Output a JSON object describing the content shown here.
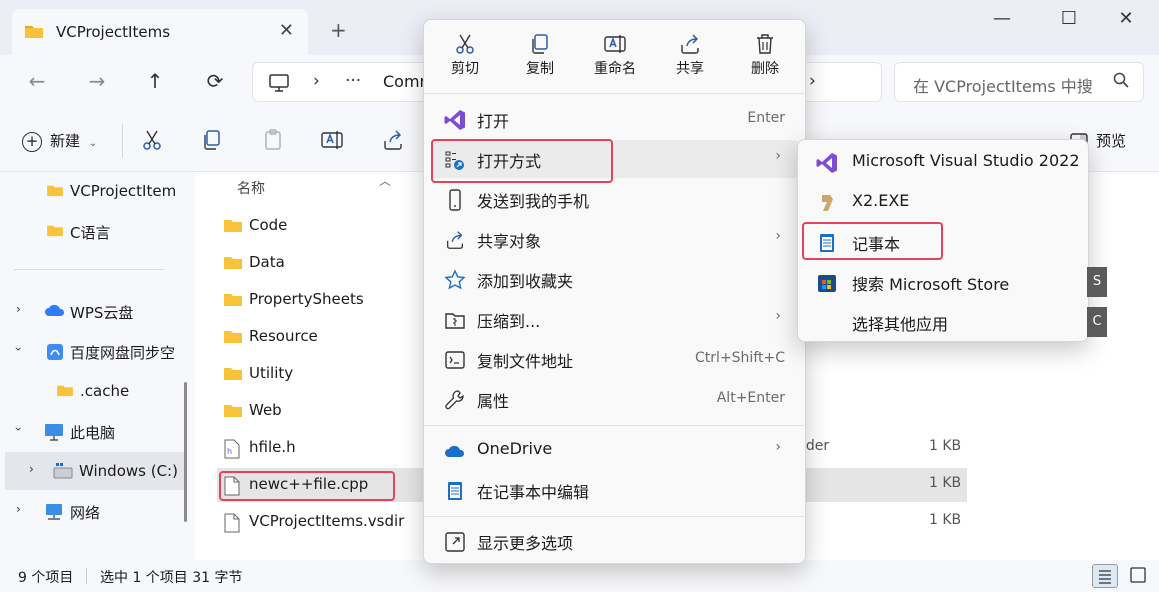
{
  "window": {
    "tab_title": "VCProjectItems",
    "tab_close": "✕",
    "new_tab": "+",
    "minimize": "—",
    "maximize": "☐",
    "close": "✕"
  },
  "nav": {
    "back": "←",
    "forward": "→",
    "up": "↑",
    "refresh": "⟳",
    "address_sep1": "›",
    "address_more": "···",
    "address_crumb": "Comm",
    "address_sep2": "›",
    "search_placeholder": "在 VCProjectItems 中搜"
  },
  "toolbar": {
    "new_label": "新建",
    "preview_label": "预览"
  },
  "sidebar": {
    "items": [
      {
        "label": "VCProjectItem",
        "icon": "folder-icon"
      },
      {
        "label": "C语言",
        "icon": "folder-icon"
      },
      {
        "label": "WPS云盘",
        "icon": "cloud-icon"
      },
      {
        "label": "百度网盘同步空",
        "icon": "baidu-icon"
      },
      {
        "label": ".cache",
        "icon": "folder-icon"
      },
      {
        "label": "此电脑",
        "icon": "pc-icon"
      },
      {
        "label": "Windows (C:)",
        "icon": "drive-icon"
      },
      {
        "label": "网络",
        "icon": "network-icon"
      }
    ]
  },
  "files": {
    "column_name": "名称",
    "rows": [
      {
        "name": "Code",
        "type": "",
        "size": "",
        "icon": "folder-icon"
      },
      {
        "name": "Data",
        "type": "",
        "size": "",
        "icon": "folder-icon"
      },
      {
        "name": "PropertySheets",
        "type": "",
        "size": "",
        "icon": "folder-icon"
      },
      {
        "name": "Resource",
        "type": "",
        "size": "",
        "icon": "folder-icon"
      },
      {
        "name": "Utility",
        "type": "",
        "size": "",
        "icon": "folder-icon"
      },
      {
        "name": "Web",
        "type": "",
        "size": "",
        "icon": "folder-icon"
      },
      {
        "name": "hfile.h",
        "type": "nder",
        "size": "1 KB",
        "icon": "header-file-icon"
      },
      {
        "name": "newc++file.cpp",
        "type": "e",
        "size": "1 KB",
        "icon": "file-icon"
      },
      {
        "name": "VCProjectItems.vsdir",
        "type": "",
        "size": "1 KB",
        "icon": "file-icon"
      }
    ]
  },
  "status": {
    "count": "9 个项目",
    "selected": "选中 1 个项目  31 字节"
  },
  "context_menu": {
    "top_actions": [
      {
        "label": "剪切",
        "icon": "scissors-icon"
      },
      {
        "label": "复制",
        "icon": "copy-icon"
      },
      {
        "label": "重命名",
        "icon": "rename-icon"
      },
      {
        "label": "共享",
        "icon": "share-icon"
      },
      {
        "label": "删除",
        "icon": "trash-icon"
      }
    ],
    "items": [
      {
        "label": "打开",
        "shortcut": "Enter",
        "arrow": "",
        "icon": "visual-studio-icon"
      },
      {
        "label": "打开方式",
        "shortcut": "",
        "arrow": "›",
        "icon": "open-with-icon"
      },
      {
        "label": "发送到我的手机",
        "shortcut": "",
        "arrow": "",
        "icon": "phone-icon"
      },
      {
        "label": "共享对象",
        "shortcut": "",
        "arrow": "›",
        "icon": "share-icon"
      },
      {
        "label": "添加到收藏夹",
        "shortcut": "",
        "arrow": "",
        "icon": "star-icon"
      },
      {
        "label": "压缩到...",
        "shortcut": "",
        "arrow": "›",
        "icon": "compress-icon"
      },
      {
        "label": "复制文件地址",
        "shortcut": "Ctrl+Shift+C",
        "arrow": "",
        "icon": "copy-path-icon"
      },
      {
        "label": "属性",
        "shortcut": "Alt+Enter",
        "arrow": "",
        "icon": "wrench-icon"
      },
      {
        "label": "OneDrive",
        "shortcut": "",
        "arrow": "›",
        "icon": "onedrive-icon"
      },
      {
        "label": "在记事本中编辑",
        "shortcut": "",
        "arrow": "",
        "icon": "notepad-icon"
      },
      {
        "label": "显示更多选项",
        "shortcut": "",
        "arrow": "",
        "icon": "more-options-icon"
      }
    ]
  },
  "submenu": {
    "items": [
      {
        "label": "Microsoft Visual Studio 2022",
        "icon": "visual-studio-icon"
      },
      {
        "label": "X2.EXE",
        "icon": "x2-icon"
      },
      {
        "label": "记事本",
        "icon": "notepad-icon"
      },
      {
        "label": "搜索 Microsoft Store",
        "icon": "store-icon"
      },
      {
        "label": "选择其他应用",
        "icon": ""
      }
    ],
    "hotkeys": [
      "S",
      "C"
    ]
  },
  "colors": {
    "highlight_box": "#e8425a",
    "folder": "#f8c33a",
    "vs_purple": "#7d4fd0",
    "accent_blue": "#1a6fc9"
  }
}
